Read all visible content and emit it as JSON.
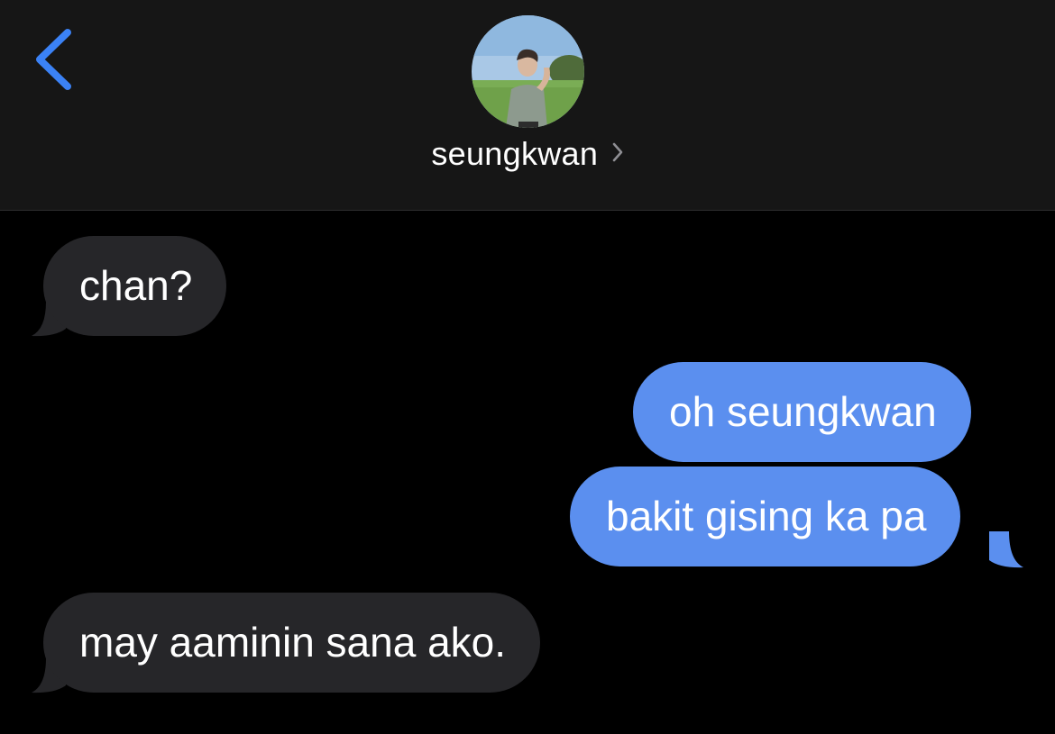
{
  "header": {
    "contact_name": "seungkwan",
    "back_icon": "chevron-left-icon",
    "detail_icon": "chevron-right-icon",
    "avatar_description": "contact-avatar-photo"
  },
  "colors": {
    "header_bg": "#161616",
    "screen_bg": "#000000",
    "incoming_bubble": "#262629",
    "outgoing_bubble": "#5b8fef",
    "accent": "#3b82f6"
  },
  "messages": [
    {
      "direction": "incoming",
      "text": "chan?"
    },
    {
      "direction": "outgoing",
      "text": "oh seungkwan"
    },
    {
      "direction": "outgoing",
      "text": "bakit gising ka pa"
    },
    {
      "direction": "incoming",
      "text": "may aaminin sana ako."
    }
  ]
}
